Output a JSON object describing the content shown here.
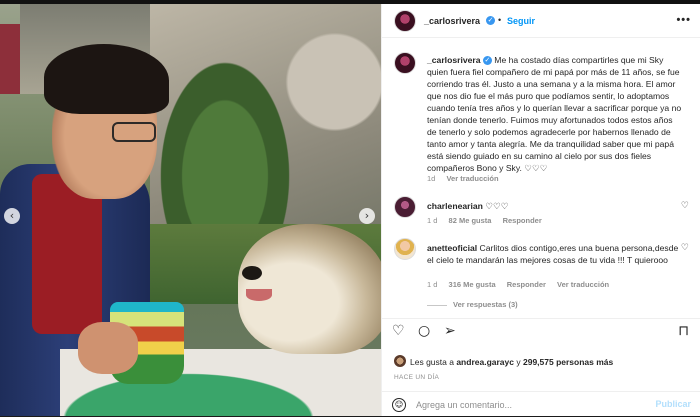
{
  "post": {
    "username": "_carlosrivera",
    "verified_icon": "verified-badge-icon",
    "follow_label": "Seguir",
    "more_label": "•••",
    "caption_username": "_carlosrivera",
    "caption": "Me ha costado días compartirles que mi Sky quien fuera fiel compañero de mi papá por más de 11 años, se fue corriendo tras él. Justo a una semana y a la misma hora. El amor que nos dio fue el más puro que podíamos sentir, lo adoptamos cuando tenía tres años y lo querían llevar a sacrificar porque ya no tenían donde tenerlo. Fuimos muy afortunados todos estos años de tenerlo y solo podemos agradecerle por habernos llenado de tanto amor y tanta alegría. Me da tranquilidad saber que mi papá está siendo guiado en su camino al cielo por sus dos fieles compañeros Bono y Sky. ♡♡♡",
    "caption_time": "1d",
    "caption_translate": "Ver traducción"
  },
  "comments": [
    {
      "username": "charlenearian",
      "text": "♡♡♡",
      "time": "1 d",
      "likes": "82 Me gusta",
      "reply": "Responder"
    },
    {
      "username": "anetteoficial",
      "text": "Carlitos dios contigo,eres una buena persona,desde el cielo te mandarán las mejores cosas de tu vida !!! T quierooo",
      "time": "1 d",
      "likes": "316 Me gusta",
      "reply": "Responder",
      "translate": "Ver traducción",
      "view_replies": "Ver respuestas (3)"
    }
  ],
  "likes": {
    "prefix": "Les gusta a",
    "user": "andrea.garayc",
    "connector": "y",
    "count": "299,575 personas",
    "suffix": "más"
  },
  "timestamp": "HACE UN DÍA",
  "add_comment": {
    "placeholder": "Agrega un comentario...",
    "publish_label": "Publicar"
  },
  "icons": {
    "like": "heart-icon",
    "comment": "comment-icon",
    "share": "share-icon",
    "save": "bookmark-icon",
    "emoji": "emoji-icon"
  },
  "colors": {
    "link_blue": "#0095f6",
    "verified": "#3897f0",
    "muted": "#8e8e8e"
  }
}
